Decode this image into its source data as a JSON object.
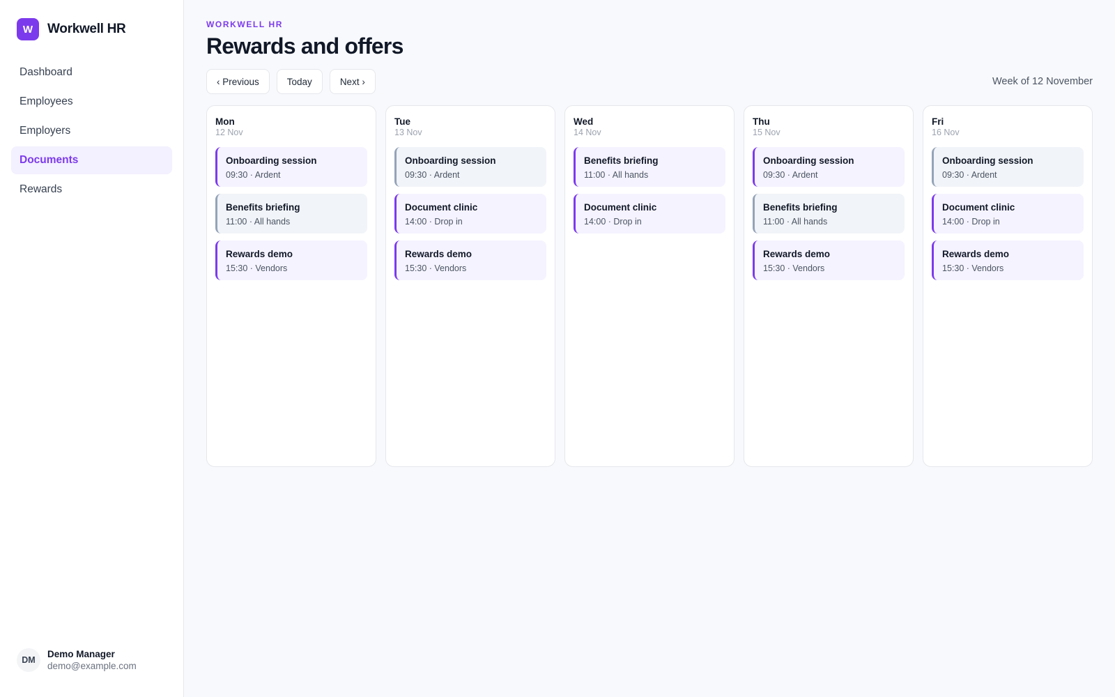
{
  "brand": {
    "logo_letter": "W",
    "name": "Workwell HR",
    "accent": "#7c3aed"
  },
  "nav": {
    "items": [
      {
        "label": "Dashboard",
        "active": false
      },
      {
        "label": "Employees",
        "active": false
      },
      {
        "label": "Employers",
        "active": false
      },
      {
        "label": "Documents",
        "active": true
      },
      {
        "label": "Rewards",
        "active": false
      }
    ]
  },
  "user": {
    "initials": "DM",
    "name": "Demo Manager",
    "email": "demo@example.com"
  },
  "header": {
    "eyebrow": "WORKWELL HR",
    "title": "Rewards and offers"
  },
  "toolbar": {
    "previous_label": "‹ Previous",
    "today_label": "Today",
    "next_label": "Next ›",
    "week_label": "Week of 12 November"
  },
  "days": [
    {
      "name": "Mon",
      "date": "12 Nov",
      "events": [
        {
          "title": "Onboarding session",
          "meta": "09:30 · Ardent",
          "variant": "accent"
        },
        {
          "title": "Benefits briefing",
          "meta": "11:00 · All hands",
          "variant": "neutral"
        },
        {
          "title": "Rewards demo",
          "meta": "15:30 · Vendors",
          "variant": "accent"
        }
      ]
    },
    {
      "name": "Tue",
      "date": "13 Nov",
      "events": [
        {
          "title": "Onboarding session",
          "meta": "09:30 · Ardent",
          "variant": "neutral"
        },
        {
          "title": "Document clinic",
          "meta": "14:00 · Drop in",
          "variant": "accent"
        },
        {
          "title": "Rewards demo",
          "meta": "15:30 · Vendors",
          "variant": "accent"
        }
      ]
    },
    {
      "name": "Wed",
      "date": "14 Nov",
      "events": [
        {
          "title": "Benefits briefing",
          "meta": "11:00 · All hands",
          "variant": "accent"
        },
        {
          "title": "Document clinic",
          "meta": "14:00 · Drop in",
          "variant": "accent"
        }
      ]
    },
    {
      "name": "Thu",
      "date": "15 Nov",
      "events": [
        {
          "title": "Onboarding session",
          "meta": "09:30 · Ardent",
          "variant": "accent"
        },
        {
          "title": "Benefits briefing",
          "meta": "11:00 · All hands",
          "variant": "neutral"
        },
        {
          "title": "Rewards demo",
          "meta": "15:30 · Vendors",
          "variant": "accent"
        }
      ]
    },
    {
      "name": "Fri",
      "date": "16 Nov",
      "events": [
        {
          "title": "Onboarding session",
          "meta": "09:30 · Ardent",
          "variant": "neutral"
        },
        {
          "title": "Document clinic",
          "meta": "14:00 · Drop in",
          "variant": "accent"
        },
        {
          "title": "Rewards demo",
          "meta": "15:30 · Vendors",
          "variant": "accent"
        }
      ]
    }
  ]
}
